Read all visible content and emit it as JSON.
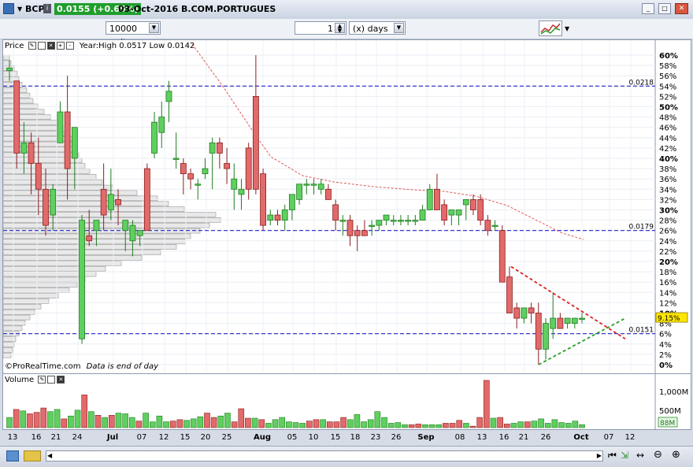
{
  "titlebar": {
    "instrument": "BCP",
    "price": "0.0155 (+0.65%)",
    "date_name": "03-Oct-2016 B.COM.PORTUGUES"
  },
  "toolbar": {
    "units": "10000 units",
    "period_value": "1",
    "period_unit": "(x) days"
  },
  "price_panel": {
    "label": "Price",
    "info": "Year:High 0.0517 Low 0.0142",
    "footer": "©ProRealTime.com",
    "footer_note": "Data is end of day",
    "current_tag": "9.15%",
    "level_labels": [
      "0.0218",
      "0.0179",
      "0.0151"
    ]
  },
  "volume_panel": {
    "label": "Volume",
    "current_tag": "88M",
    "axis_labels": [
      "1,000M",
      "500M"
    ]
  },
  "chart_data": {
    "type": "candlestick",
    "y_axis_unit": "%",
    "y_ticks": [
      "0%",
      "2%",
      "4%",
      "6%",
      "8%",
      "10%",
      "12%",
      "14%",
      "16%",
      "18%",
      "20%",
      "22%",
      "24%",
      "26%",
      "28%",
      "30%",
      "32%",
      "34%",
      "36%",
      "38%",
      "40%",
      "42%",
      "44%",
      "46%",
      "48%",
      "50%",
      "52%",
      "54%",
      "56%",
      "58%",
      "60%"
    ],
    "x_ticks": [
      "13",
      "16",
      "21",
      "24",
      "Jul",
      "07",
      "12",
      "15",
      "20",
      "25",
      "Aug",
      "05",
      "10",
      "15",
      "18",
      "23",
      "26",
      "Sep",
      "08",
      "13",
      "16",
      "21",
      "26",
      "Oct",
      "07",
      "12"
    ],
    "ylim": [
      0,
      60
    ],
    "horizontal_levels": [
      {
        "label": "0.0218",
        "value": 54
      },
      {
        "label": "0.0179",
        "value": 26
      },
      {
        "label": "0.0151",
        "value": 6
      }
    ],
    "candles": [
      [
        57,
        59,
        55,
        57.5
      ],
      [
        55,
        55,
        38,
        41
      ],
      [
        41,
        47,
        37,
        43
      ],
      [
        43,
        45,
        33,
        39
      ],
      [
        39,
        44,
        29,
        34
      ],
      [
        34,
        38,
        25,
        27
      ],
      [
        29,
        35,
        26,
        34
      ],
      [
        43,
        51,
        43,
        49
      ],
      [
        49,
        56,
        32,
        38
      ],
      [
        40,
        46,
        34,
        46
      ],
      [
        5,
        29,
        4,
        28
      ],
      [
        25,
        30,
        23,
        24
      ],
      [
        26,
        28,
        23,
        28
      ],
      [
        34,
        39,
        26,
        29
      ],
      [
        30,
        38,
        28,
        33
      ],
      [
        32,
        34,
        27,
        31
      ],
      [
        26,
        27,
        22,
        28
      ],
      [
        24,
        28,
        21,
        27
      ],
      [
        25,
        26,
        23,
        26
      ],
      [
        38,
        39,
        26,
        26
      ],
      [
        41,
        49,
        40,
        47
      ],
      [
        45,
        51,
        42,
        48
      ],
      [
        51,
        55,
        47,
        53
      ],
      [
        40,
        45,
        38,
        40
      ],
      [
        39,
        40,
        33,
        37
      ],
      [
        37,
        38,
        34,
        36
      ],
      [
        35,
        36,
        32,
        35
      ],
      [
        37,
        40,
        36,
        38
      ],
      [
        41,
        44,
        34,
        43
      ],
      [
        43,
        44,
        38,
        41
      ],
      [
        39,
        42,
        35,
        38
      ],
      [
        34,
        39,
        30,
        36
      ],
      [
        33,
        36,
        30,
        34
      ],
      [
        42,
        43,
        32,
        34
      ],
      [
        52,
        60,
        33,
        34
      ],
      [
        37,
        38,
        26,
        27
      ],
      [
        28,
        30,
        27,
        29
      ],
      [
        29,
        30,
        27,
        28
      ],
      [
        28,
        31,
        26,
        30
      ],
      [
        30,
        32,
        28,
        33
      ],
      [
        32,
        35,
        31,
        35
      ],
      [
        35,
        36,
        33,
        35
      ],
      [
        35,
        36,
        33,
        35
      ],
      [
        34,
        36,
        33,
        35
      ],
      [
        34,
        35,
        32,
        32
      ],
      [
        31,
        32,
        26,
        28
      ],
      [
        28,
        29,
        25,
        28
      ],
      [
        28,
        29,
        23,
        25
      ],
      [
        26,
        27,
        22,
        25
      ],
      [
        26,
        28,
        25,
        25
      ],
      [
        27,
        28,
        25,
        27
      ],
      [
        27,
        28,
        26,
        28
      ],
      [
        28,
        29,
        27,
        29
      ],
      [
        28,
        29,
        27,
        28
      ],
      [
        28,
        29,
        27,
        28
      ],
      [
        28,
        29,
        27,
        28
      ],
      [
        28,
        29,
        27,
        28
      ],
      [
        28,
        31,
        28,
        30
      ],
      [
        30,
        35,
        30,
        34
      ],
      [
        34,
        37,
        30,
        30
      ],
      [
        31,
        32,
        27,
        28
      ],
      [
        29,
        30,
        27,
        30
      ],
      [
        29,
        30,
        27,
        30
      ],
      [
        31,
        32,
        28,
        32
      ],
      [
        32,
        33,
        29,
        30
      ],
      [
        32,
        33,
        27,
        28
      ],
      [
        28,
        29,
        25,
        26
      ],
      [
        27,
        28,
        26,
        27
      ],
      [
        26,
        27,
        24,
        16
      ],
      [
        17,
        19,
        15,
        10
      ],
      [
        11,
        12,
        7,
        9
      ],
      [
        9,
        11,
        8,
        11
      ],
      [
        11,
        12,
        8,
        10
      ],
      [
        10,
        12,
        0,
        3
      ],
      [
        3,
        9,
        1,
        8
      ],
      [
        7,
        14,
        5,
        9
      ],
      [
        9,
        10,
        7,
        7
      ],
      [
        8,
        9,
        7,
        9
      ],
      [
        8,
        9,
        7,
        9
      ],
      [
        9,
        10,
        8,
        9
      ]
    ],
    "volume": [
      14,
      25,
      23,
      19,
      21,
      27,
      22,
      25,
      12,
      16,
      24,
      45,
      22,
      17,
      14,
      17,
      20,
      19,
      14,
      9,
      20,
      8,
      16,
      8,
      9,
      11,
      10,
      12,
      15,
      20,
      14,
      16,
      20,
      8,
      26,
      13,
      13,
      11,
      6,
      11,
      14,
      8,
      7,
      6,
      9,
      11,
      11,
      8,
      8,
      14,
      11,
      18,
      8,
      11,
      22,
      14,
      6,
      7,
      4,
      4,
      5,
      4,
      4,
      4,
      6,
      6,
      10,
      6,
      2,
      14,
      65,
      13,
      14,
      5,
      6,
      8,
      8,
      9,
      12,
      6,
      11,
      7,
      6,
      9,
      4
    ]
  }
}
